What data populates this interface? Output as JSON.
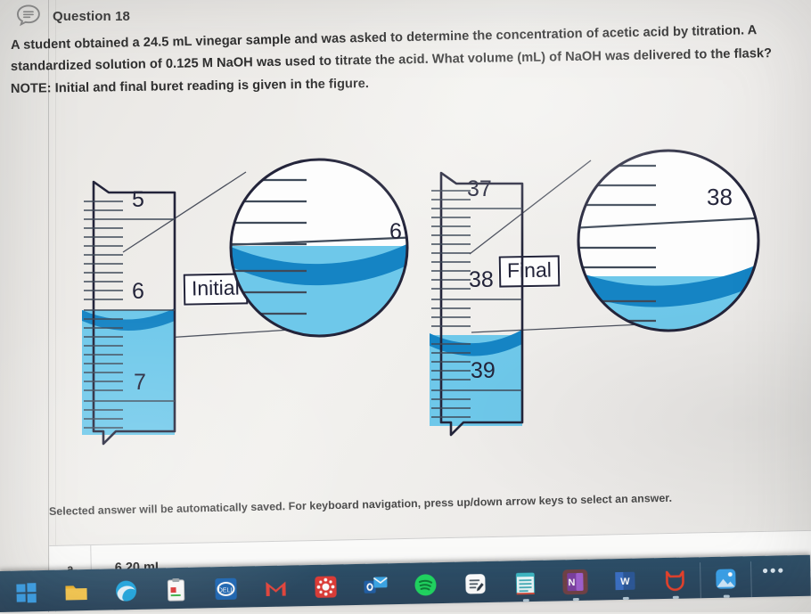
{
  "header": {
    "icon": "speech-bubble-question-icon",
    "title": "Question 18"
  },
  "question": {
    "line1": "A student obtained a 24.5 mL vinegar sample and was asked to determine the concentration of acetic acid by titration. A",
    "line2": "standardized solution of 0.125 M NaOH was used to titrate the acid.  What  volume (mL) of NaOH was delivered to the flask?",
    "line3": "NOTE: Initial and final buret reading is given in the figure."
  },
  "figure": {
    "initial": {
      "label": "Initial",
      "buret_top_number": "5",
      "buret_mid_number": "6",
      "buret_bottom_number": "7",
      "magnifier_number": "6"
    },
    "final": {
      "label": "Final",
      "buret_top_number": "37",
      "buret_mid_number": "38",
      "buret_bottom_number": "39",
      "magnifier_number": "38"
    },
    "colors": {
      "liquid_light": "#6ec8ea",
      "liquid_meniscus": "#1584c4",
      "outline": "#23243a",
      "tick": "#3f4a59"
    }
  },
  "footer": {
    "save_note": "Selected answer will be automatically saved. For keyboard navigation, press up/down arrow keys to select an answer."
  },
  "answers": [
    {
      "key": "a",
      "text": "6.20 mL"
    }
  ],
  "taskbar": {
    "overflow": "•••",
    "items": [
      {
        "name": "start-icon",
        "glyph": "win",
        "color": "#2b7fd4",
        "running": false
      },
      {
        "name": "folder-icon",
        "glyph": "folder",
        "color": "#f0b429",
        "running": false
      },
      {
        "name": "browser-icon",
        "glyph": "edge",
        "color": "#1ea7e1",
        "running": false
      },
      {
        "name": "notes-app-icon",
        "glyph": "clipboard",
        "color": "#ffffff",
        "running": false
      },
      {
        "name": "dell-icon",
        "glyph": "dell",
        "color": "#1b66b5",
        "running": false
      },
      {
        "name": "gmail-icon",
        "glyph": "gmail",
        "color": "#e8453c",
        "running": false
      },
      {
        "name": "canvas-icon",
        "glyph": "canvas",
        "color": "#e03b36",
        "running": false
      },
      {
        "name": "outlook-icon",
        "glyph": "outlook",
        "color": "#1f88d8",
        "running": false
      },
      {
        "name": "spotify-icon",
        "glyph": "spotify",
        "color": "#1ed760",
        "running": false
      },
      {
        "name": "sticky-notes-icon",
        "glyph": "stickynote",
        "color": "#ffffff",
        "running": false
      },
      {
        "name": "notepad-icon",
        "glyph": "notepad",
        "color": "#3fb8c4",
        "running": true
      },
      {
        "name": "onenote-icon",
        "glyph": "onenote",
        "color": "#7b3fa0",
        "running": true
      },
      {
        "name": "word-icon",
        "glyph": "word",
        "color": "#2b5797",
        "running": true
      },
      {
        "name": "tomcat-icon",
        "glyph": "cat",
        "color": "#e8402a",
        "running": true
      },
      {
        "name": "photos-icon",
        "glyph": "photos",
        "color": "#3aa0e8",
        "running": true
      }
    ]
  }
}
